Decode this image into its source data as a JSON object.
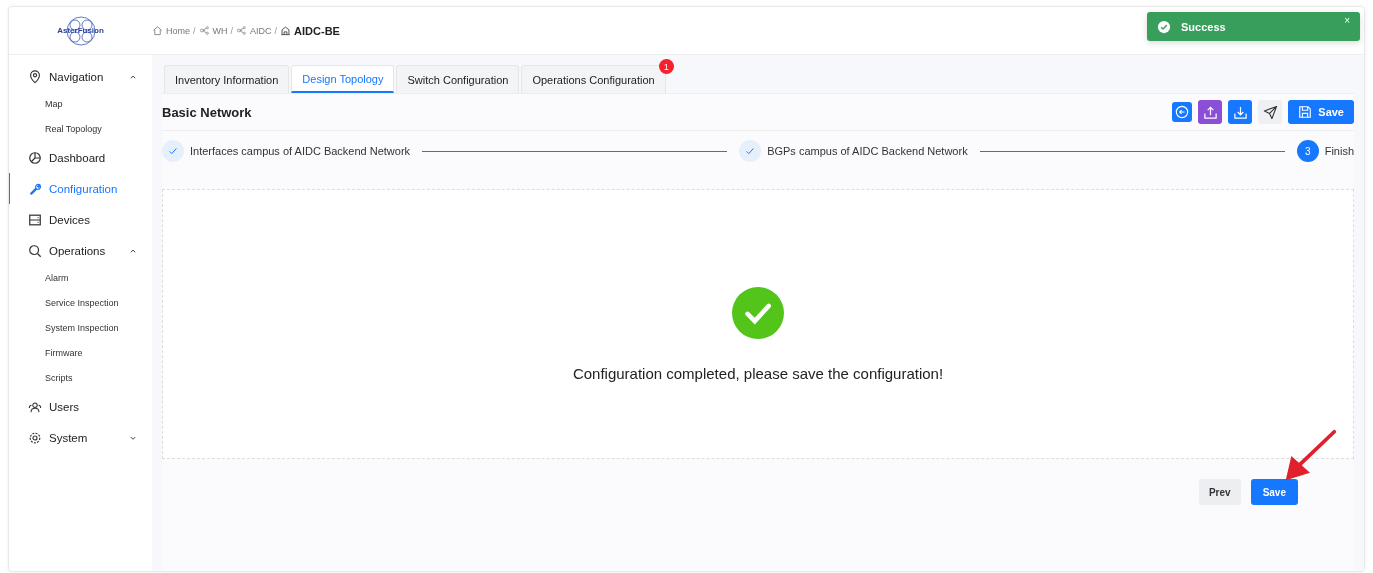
{
  "logo": {
    "text": "AsterFusion"
  },
  "breadcrumb_separator": "/",
  "breadcrumb": [
    {
      "label": "Home",
      "current": false
    },
    {
      "label": "WH",
      "current": false
    },
    {
      "label": "AIDC",
      "current": false
    },
    {
      "label": "AIDC-BE",
      "current": true
    }
  ],
  "toast": {
    "kind": "success",
    "text": "Success",
    "close": "×"
  },
  "sidebar": {
    "items": [
      {
        "label": "Navigation",
        "selected": false,
        "expanded": true,
        "children": [
          {
            "label": "Map",
            "selected": false
          },
          {
            "label": "Real Topology",
            "selected": false
          }
        ]
      },
      {
        "label": "Dashboard",
        "selected": false
      },
      {
        "label": "Configuration",
        "selected": true
      },
      {
        "label": "Devices",
        "selected": false
      },
      {
        "label": "Operations",
        "selected": false,
        "expanded": true,
        "children": [
          {
            "label": "Alarm",
            "selected": false
          },
          {
            "label": "Service Inspection",
            "selected": false
          },
          {
            "label": "System Inspection",
            "selected": false
          },
          {
            "label": "Firmware",
            "selected": false
          },
          {
            "label": "Scripts",
            "selected": false
          }
        ]
      },
      {
        "label": "Users",
        "selected": false
      },
      {
        "label": "System",
        "selected": false,
        "expanded": false
      }
    ]
  },
  "tabs": [
    {
      "label": "Inventory Information",
      "selected": false
    },
    {
      "label": "Design Topology",
      "selected": true
    },
    {
      "label": "Switch Configuration",
      "selected": false
    },
    {
      "label": "Operations Configuration",
      "selected": false,
      "badge": "1"
    }
  ],
  "panel": {
    "title": "Basic Network",
    "save_label": "Save"
  },
  "steps": [
    {
      "label": "Interfaces campus of AIDC Backend Network",
      "completed": true
    },
    {
      "label": "BGPs campus of AIDC Backend Network",
      "completed": true
    },
    {
      "label": "Finish",
      "completed": false,
      "number": "3"
    }
  ],
  "result": {
    "message": "Configuration completed, please save the configuration!"
  },
  "footer_buttons": [
    {
      "label": "Prev",
      "kind": "default"
    },
    {
      "label": "Save",
      "kind": "primary"
    }
  ]
}
